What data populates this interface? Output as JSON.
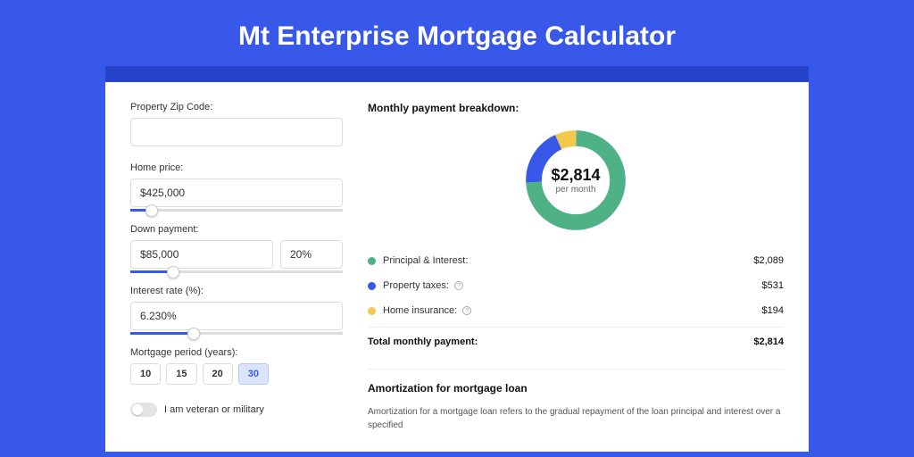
{
  "title": "Mt Enterprise Mortgage Calculator",
  "form": {
    "zip": {
      "label": "Property Zip Code:",
      "value": ""
    },
    "homePrice": {
      "label": "Home price:",
      "value": "$425,000",
      "sliderPct": 10
    },
    "downPayment": {
      "label": "Down payment:",
      "amount": "$85,000",
      "percent": "20%",
      "sliderPct": 20
    },
    "interestRate": {
      "label": "Interest rate (%):",
      "value": "6.230%",
      "sliderPct": 30
    },
    "period": {
      "label": "Mortgage period (years):",
      "options": [
        "10",
        "15",
        "20",
        "30"
      ],
      "selected": "30"
    },
    "veteran": {
      "label": "I am veteran or military",
      "on": false
    }
  },
  "breakdown": {
    "heading": "Monthly payment breakdown:",
    "total": "$2,814",
    "totalSub": "per month",
    "items": [
      {
        "key": "principal_interest",
        "label": "Principal & Interest:",
        "value": "$2,089",
        "hasInfo": false
      },
      {
        "key": "property_taxes",
        "label": "Property taxes:",
        "value": "$531",
        "hasInfo": true
      },
      {
        "key": "home_insurance",
        "label": "Home insurance:",
        "value": "$194",
        "hasInfo": true
      }
    ],
    "totalLabel": "Total monthly payment:",
    "totalValue": "$2,814"
  },
  "amortization": {
    "heading": "Amortization for mortgage loan",
    "text": "Amortization for a mortgage loan refers to the gradual repayment of the loan principal and interest over a specified"
  },
  "chart_data": {
    "type": "pie",
    "title": "Monthly payment breakdown",
    "series": [
      {
        "name": "Principal & Interest",
        "value": 2089,
        "color": "#4fb286"
      },
      {
        "name": "Property taxes",
        "value": 531,
        "color": "#3858e9"
      },
      {
        "name": "Home insurance",
        "value": 194,
        "color": "#f2c94c"
      }
    ],
    "total": 2814,
    "center_label": "$2,814 per month"
  }
}
